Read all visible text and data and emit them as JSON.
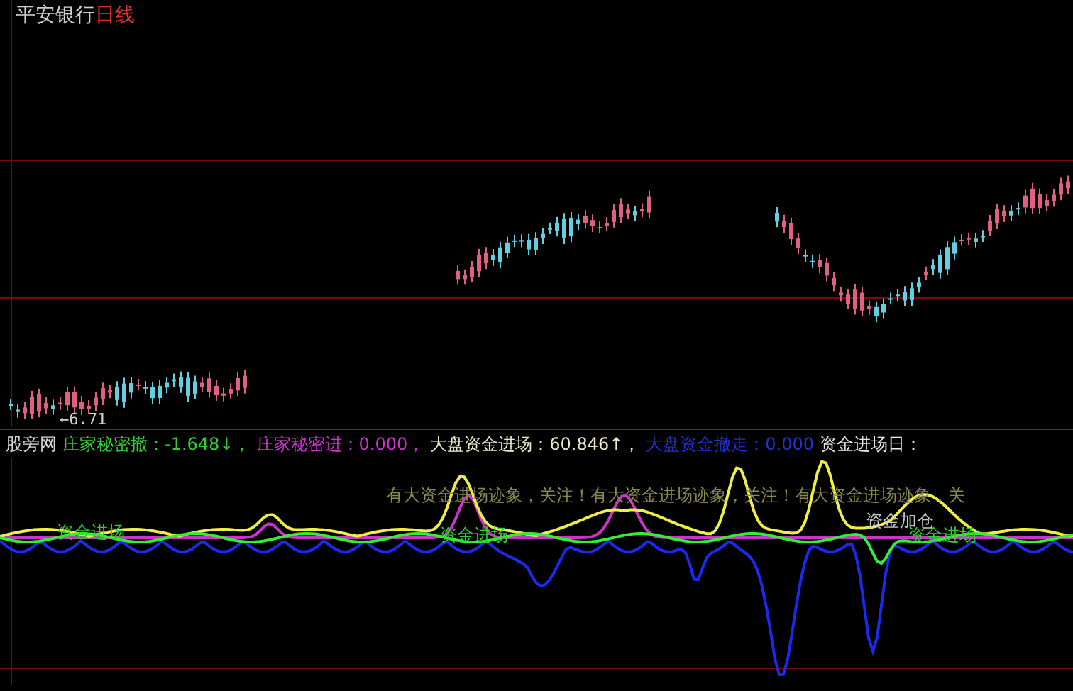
{
  "chart_title": {
    "stock": "平安银行",
    "period": "日线"
  },
  "price_marker": "←6.71",
  "indicator": {
    "name": "股旁网",
    "readouts": [
      {
        "text": "庄家秘密撤：-1.648↓，",
        "color": "#33cc33"
      },
      {
        "text": "庄家秘密进：0.000，",
        "color": "#cc33cc"
      },
      {
        "text": "大盘资金进场：60.846↑，",
        "color": "#e8e8c8"
      },
      {
        "text": "大盘资金撤走：0.000",
        "color": "#2233cc"
      },
      {
        "text": "资金进场日：",
        "color": "#e8e8e8"
      }
    ]
  },
  "signals": {
    "banner": "有大资金进场迹象，关注！有大资金进场迹象，关注！有大资金进场迹象，关",
    "labels": [
      {
        "text": "资金进场",
        "color": "#33cc33"
      },
      {
        "text": "资金进场",
        "color": "#33cc33"
      },
      {
        "text": "资金加仓",
        "color": "#c8c8c8"
      },
      {
        "text": "资金进场",
        "color": "#33cc33"
      }
    ]
  }
}
